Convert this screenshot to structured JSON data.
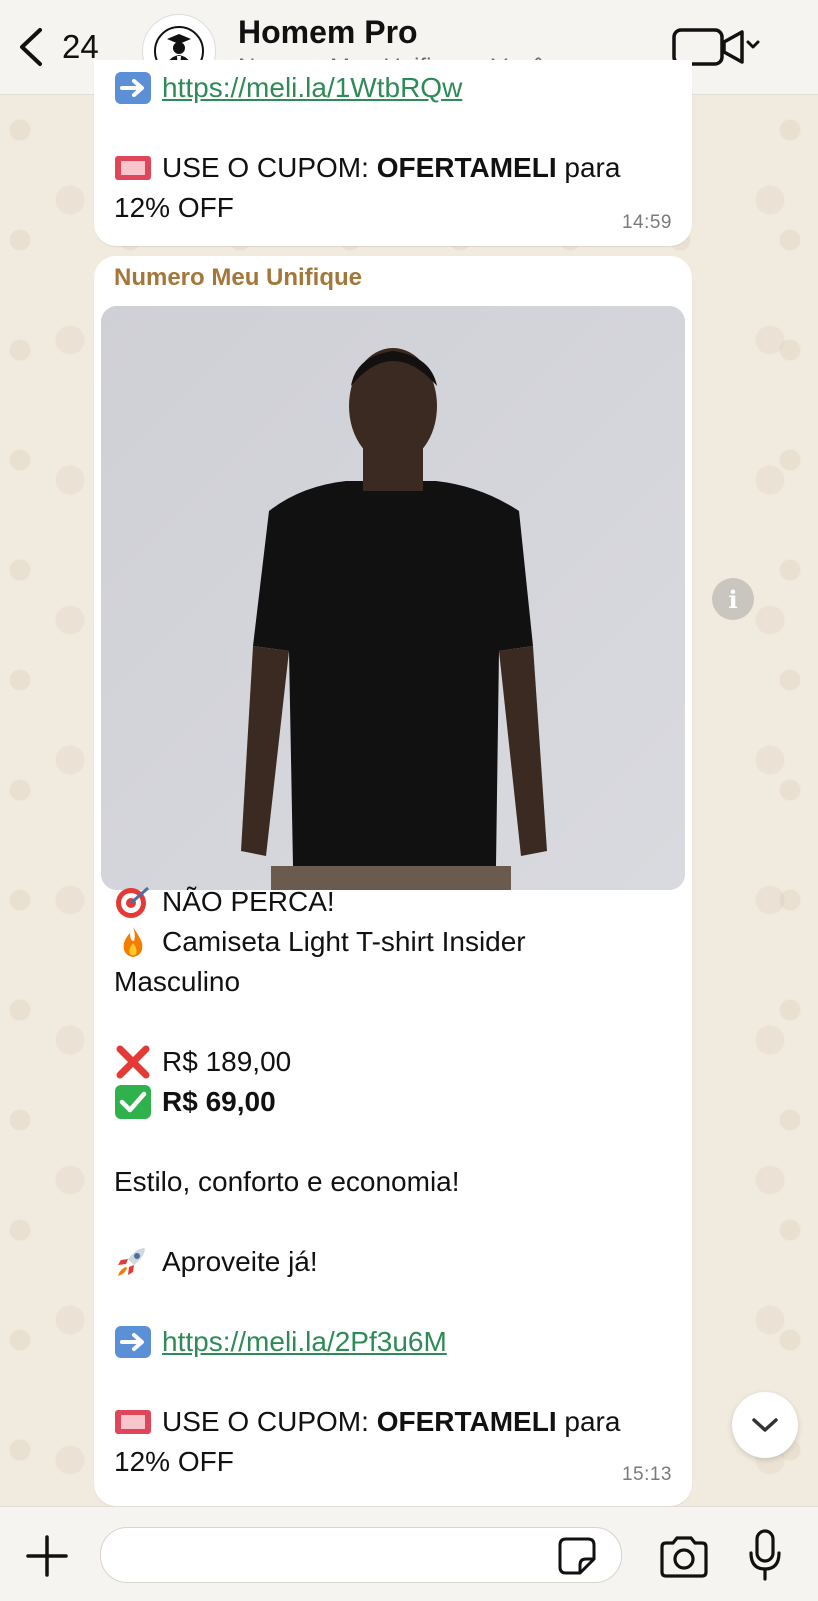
{
  "header": {
    "back_count": "24",
    "title": "Homem Pro",
    "subtitle": "Numero Meu Unifique , Você"
  },
  "messages": [
    {
      "link_partial": "https://meli.la/1WtbRQw",
      "coupon_prefix": "USE O CUPOM: ",
      "coupon_code": "OFERTAMELI",
      "coupon_suffix": " para",
      "coupon_line2": "12% OFF",
      "time": "14:59"
    },
    {
      "sender": "Numero Meu Unifique",
      "headline": "NÃO PERCA!",
      "product_line1": "Camiseta Light T-shirt Insider",
      "product_line2": "Masculino",
      "old_price": "R$ 189,00",
      "new_price": "R$ 69,00",
      "tagline": "Estilo, conforto e economia!",
      "cta": "Aproveite já!",
      "link": "https://meli.la/2Pf3u6M",
      "coupon_prefix": "USE O CUPOM: ",
      "coupon_code": "OFERTAMELI",
      "coupon_suffix": " para",
      "coupon_line2": "12% OFF",
      "time": "15:13"
    }
  ],
  "colors": {
    "sender": "#a5763a",
    "link": "#2e8b57",
    "check": "#2fb24c",
    "cross": "#e53935"
  },
  "icons": {
    "back": "chevron-left-icon",
    "video": "video-camera-icon",
    "info": "info-icon",
    "scroll": "chevron-down-icon",
    "plus": "plus-icon",
    "sticker": "sticker-icon",
    "camera": "camera-icon",
    "mic": "microphone-icon"
  }
}
